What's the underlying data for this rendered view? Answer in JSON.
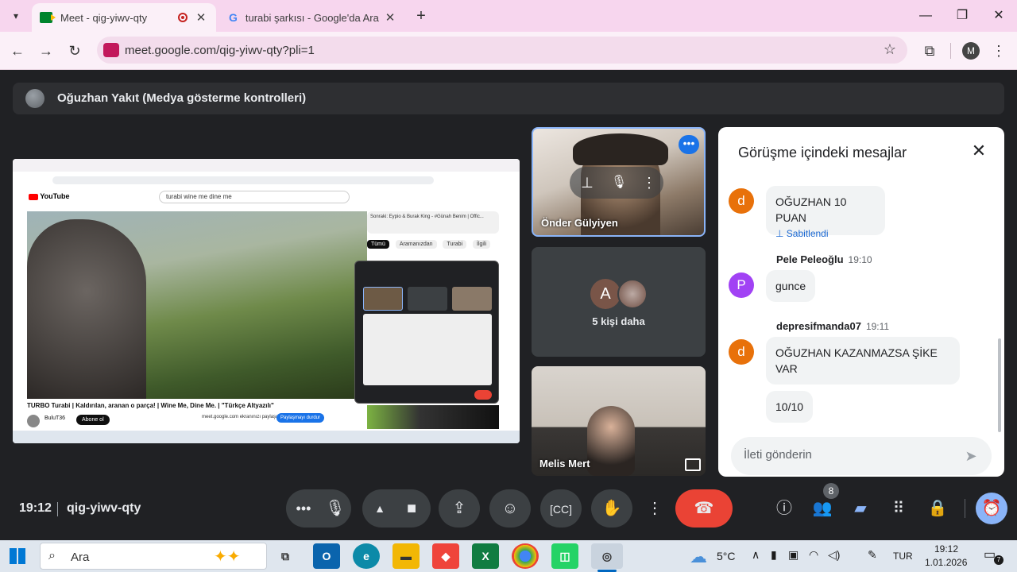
{
  "browser": {
    "tabs": [
      {
        "title": "Meet - qig-yiwv-qty",
        "active": true
      },
      {
        "title": "turabi şarkısı - Google'da Ara",
        "active": false
      }
    ],
    "url": "meet.google.com/qig-yiwv-qty?pli=1",
    "profile_initial": "M"
  },
  "meet": {
    "presenter_label": "Oğuzhan Yakıt (Medya gösterme kontrolleri)",
    "participants": [
      {
        "name": "Önder Gülyiyen"
      },
      {
        "name": "5 kişi daha",
        "avatars": [
          "A"
        ]
      },
      {
        "name": "Melis Mert"
      }
    ],
    "clock": "19:12",
    "meeting_code": "qig-yiwv-qty",
    "people_count": "8"
  },
  "shared_screen": {
    "search_query": "turabi wine me dine me",
    "video_title": "TURBO Turabi | Kaldırılan, aranan o parça! | Wine Me, Dine Me. | \"Türkçe Altyazılı\"",
    "channel": "BuluT36",
    "subscribe": "Abone ol",
    "sharing_notice": "meet.google.com ekranınızı paylaşıyor.",
    "stop_sharing": "Paylaşmayı durdur",
    "next_up": "Sonraki: Eypio & Burak King - #Günah Benim | Offic...",
    "chips": [
      "Tümü",
      "Aramanızdan",
      "Turabi",
      "İlgili"
    ]
  },
  "chat": {
    "title": "Görüşme içindeki mesajlar",
    "messages": [
      {
        "initial": "d",
        "color": "#e8710a",
        "text": "OĞUZHAN 10 PUAN",
        "pinned": "Sabitlendi"
      },
      {
        "sender": "Pele Peleoğlu",
        "time": "19:10",
        "initial": "P",
        "color": "#a142f4",
        "text": "gunce"
      },
      {
        "sender": "depresifmanda07",
        "time": "19:11",
        "initial": "d",
        "color": "#e8710a",
        "text": "OĞUZHAN KAZANMAZSA ŞİKE VAR",
        "text2": "10/10"
      }
    ],
    "input_placeholder": "İleti gönderin"
  },
  "taskbar": {
    "search_placeholder": "Ara",
    "weather": "5°C",
    "language": "TUR",
    "time": "19:12",
    "date": "1.01.2026",
    "notifications": "7"
  }
}
